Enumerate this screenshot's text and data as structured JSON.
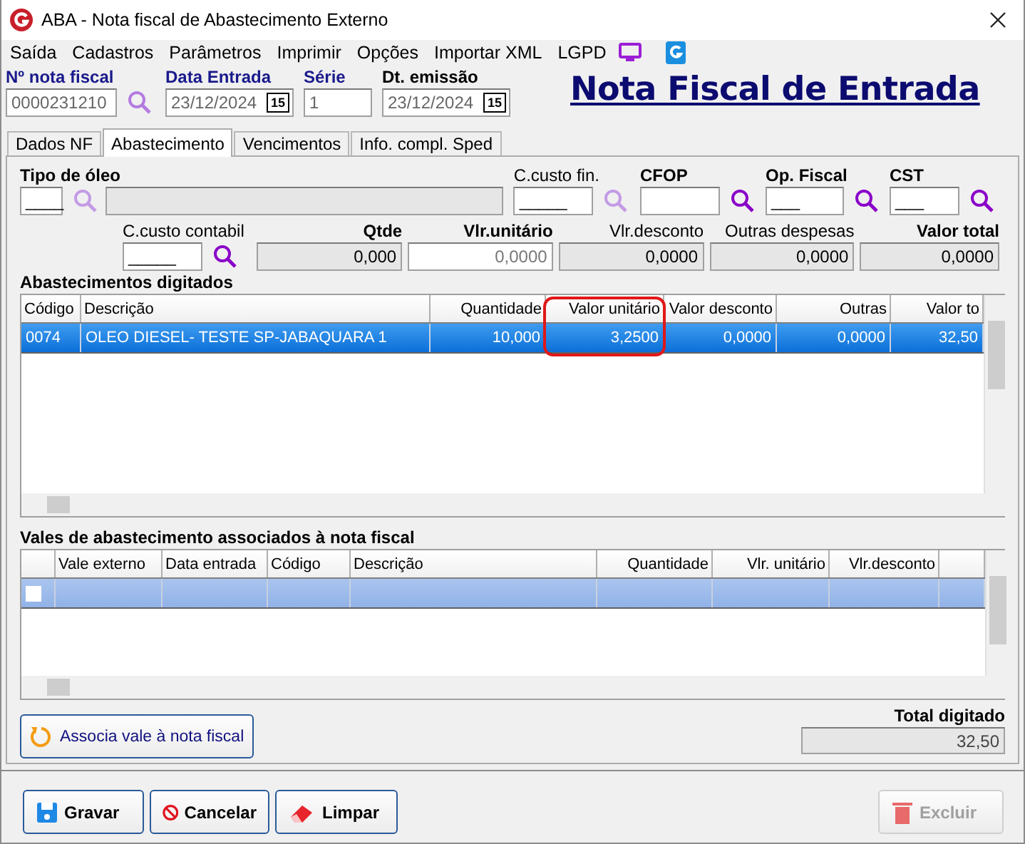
{
  "window": {
    "title": "ABA - Nota fiscal de Abastecimento Externo"
  },
  "menu": [
    {
      "label": "Saída"
    },
    {
      "label": "Cadastros"
    },
    {
      "label": "Parâmetros"
    },
    {
      "label": "Imprimir"
    },
    {
      "label": "Opções"
    },
    {
      "label": "Importar XML"
    },
    {
      "label": "LGPD"
    }
  ],
  "header_fields": [
    {
      "label": "Nº nota fiscal",
      "value": "0000231210",
      "kind": "search",
      "required": true
    },
    {
      "label": "Data Entrada",
      "value": "23/12/2024",
      "kind": "date",
      "picker": "15",
      "required": true
    },
    {
      "label": "Série",
      "value": "1",
      "kind": "text",
      "required": true
    },
    {
      "label": "Dt. emissão",
      "value": "23/12/2024",
      "kind": "date",
      "picker": "15",
      "required": false
    }
  ],
  "page_title": "Nota Fiscal de Entrada",
  "tabs": [
    {
      "label": "Dados NF",
      "selected": false
    },
    {
      "label": "Abastecimento",
      "selected": true
    },
    {
      "label": "Vencimentos",
      "selected": false
    },
    {
      "label": "Info. compl. Sped",
      "selected": false
    }
  ],
  "lookup_fields": [
    {
      "label": "Tipo de óleo",
      "value": "____",
      "required": true,
      "search_enabled": false,
      "kind": "with_description"
    },
    {
      "label": "C.custo fin.",
      "value": "_____",
      "required": false,
      "search_enabled": false,
      "kind": "plain"
    },
    {
      "label": "CFOP",
      "required": true,
      "search_enabled": true,
      "kind": "plain"
    },
    {
      "label": "Op. Fiscal",
      "value": "___",
      "required": true,
      "search_enabled": true,
      "kind": "plain"
    },
    {
      "label": "CST",
      "value": "___",
      "required": true,
      "search_enabled": true,
      "kind": "plain"
    }
  ],
  "cost_center": {
    "label": "C.custo contabil",
    "value": "_____",
    "required": false,
    "search_enabled": true
  },
  "amounts": [
    {
      "label": "Qtde",
      "value": "0,000",
      "required": true,
      "readonly": true
    },
    {
      "label": "Vlr.unitário",
      "value": "0,0000",
      "required": true,
      "readonly": false
    },
    {
      "label": "Vlr.desconto",
      "value": "0,0000",
      "required": false,
      "readonly": true
    },
    {
      "label": "Outras despesas",
      "value": "0,0000",
      "required": false,
      "readonly": true
    },
    {
      "label": "Valor total",
      "value": "0,0000",
      "required": true,
      "readonly": true
    }
  ],
  "supplies": {
    "title": "Abastecimentos digitados",
    "columns": [
      {
        "label": "Código",
        "kind": "text",
        "highlight": false
      },
      {
        "label": "Descrição",
        "kind": "text",
        "highlight": false
      },
      {
        "label": "Quantidade",
        "kind": "number",
        "highlight": false
      },
      {
        "label": "Valor unitário",
        "kind": "number",
        "highlight": true
      },
      {
        "label": "Valor desconto",
        "kind": "number",
        "highlight": false
      },
      {
        "label": "Outras",
        "kind": "number",
        "highlight": false
      },
      {
        "label": "Valor to",
        "kind": "number",
        "highlight": false
      }
    ],
    "rows": [
      {
        "selected": true,
        "cells": [
          "0074",
          "OLEO DIESEL- TESTE SP-JABAQUARA 1",
          "10,000",
          "3,2500",
          "0,0000",
          "0,0000",
          "32,50"
        ]
      }
    ]
  },
  "vouchers": {
    "title": "Vales de abastecimento associados à nota fiscal",
    "columns": [
      {
        "label": "Vale externo",
        "kind": "text"
      },
      {
        "label": "Data entrada",
        "kind": "text"
      },
      {
        "label": "Código",
        "kind": "text"
      },
      {
        "label": "Descrição",
        "kind": "text"
      },
      {
        "label": "Quantidade",
        "kind": "number"
      },
      {
        "label": "Vlr. unitário",
        "kind": "number"
      },
      {
        "label": "Vlr.desconto",
        "kind": "number"
      }
    ],
    "rows": [
      {
        "checked": false,
        "selected": true
      }
    ]
  },
  "associate_button": "Associa vale à nota fiscal",
  "total": {
    "label": "Total digitado",
    "value": "32,50"
  },
  "actions": [
    {
      "label": "Gravar",
      "kind": "save",
      "disabled": false
    },
    {
      "label": "Cancelar",
      "kind": "cancel",
      "disabled": false
    },
    {
      "label": "Limpar",
      "kind": "clear",
      "disabled": false
    },
    {
      "label": "Excluir",
      "kind": "delete",
      "disabled": true
    }
  ]
}
